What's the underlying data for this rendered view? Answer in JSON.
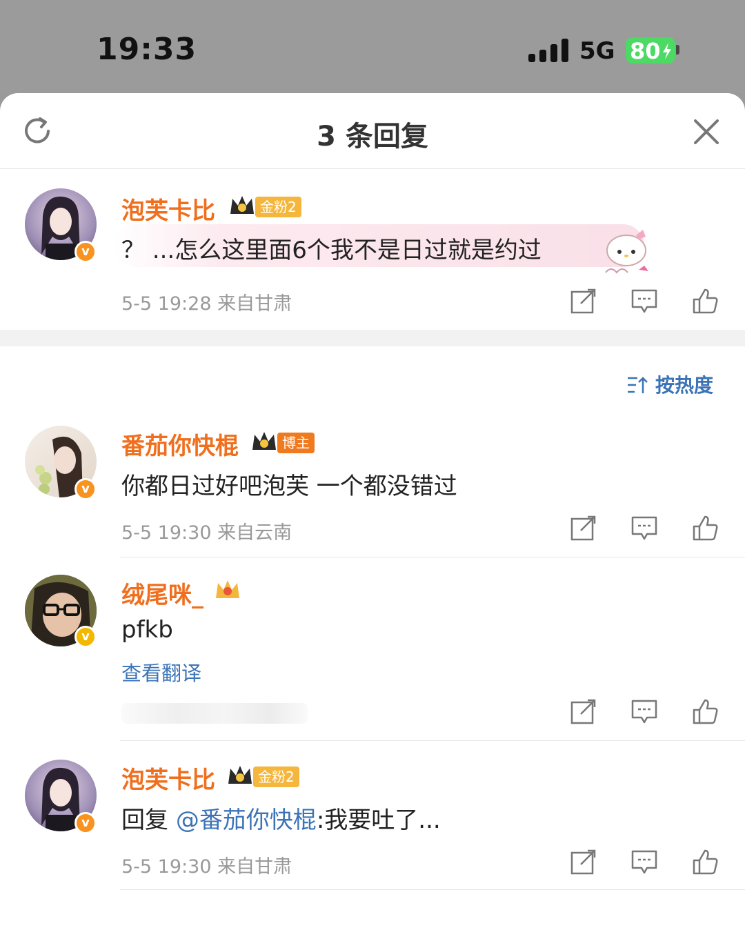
{
  "status_bar": {
    "time": "19:33",
    "network": "5G",
    "battery": "80"
  },
  "header": {
    "title": "3 条回复"
  },
  "sort": {
    "label": "按热度"
  },
  "main_comment": {
    "name": "泡芙卡比",
    "badge": "金粉2",
    "text": "？ ...怎么这里面6个我不是日过就是约过",
    "meta": "5-5 19:28  来自甘肃"
  },
  "replies": [
    {
      "name": "番茄你快棍",
      "badge": "博主",
      "text": "你都日过好吧泡芙 一个都没错过",
      "meta": "5-5 19:30  来自云南"
    },
    {
      "name": "绒尾咪_",
      "text": "pfkb",
      "translate": "查看翻译"
    },
    {
      "name": "泡芙卡比",
      "badge": "金粉2",
      "text_prefix": "回复 ",
      "mention": "@番茄你快棍",
      "text_suffix": ":我要吐了...",
      "meta": "5-5 19:30  来自甘肃"
    }
  ],
  "colors": {
    "name": "#f06f1e",
    "link": "#3b73b6",
    "meta": "#999999",
    "verified": "#f7931e"
  }
}
